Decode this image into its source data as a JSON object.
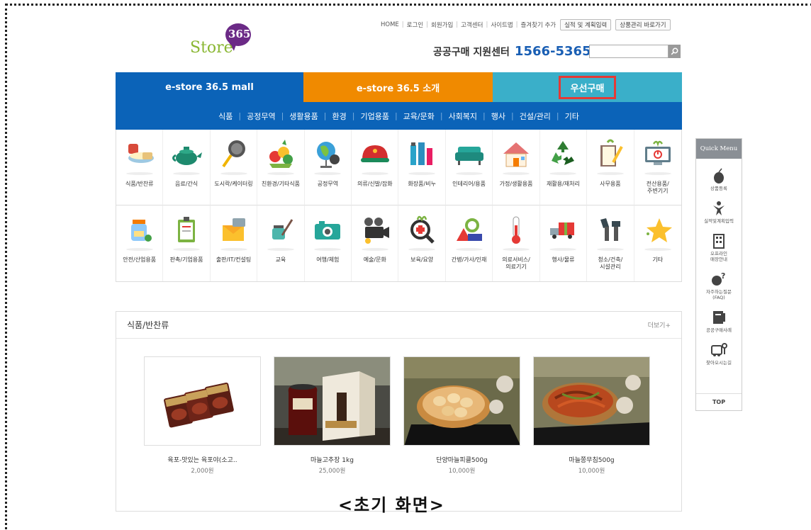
{
  "top_links": {
    "items": [
      "HOME",
      "로그인",
      "회원가입",
      "고객센터",
      "사이트맵",
      "즐겨찾기 추가"
    ],
    "buttons": [
      "실적 및 계획입력",
      "상품관리 바로가기"
    ]
  },
  "logo": {
    "number": "365",
    "word": "Store"
  },
  "support": {
    "label": "공공구매 지원센터",
    "phone": "1566-5365"
  },
  "tabs": [
    "e-store 36.5 mall",
    "e-store 36.5 소개",
    "우선구매"
  ],
  "subnav": [
    "식품",
    "공정무역",
    "생활용품",
    "환경",
    "기업용품",
    "교육/문화",
    "사회복지",
    "행사",
    "건설/관리",
    "기타"
  ],
  "categories": [
    {
      "label": "식품/반찬류",
      "icon": "food-bowl-icon"
    },
    {
      "label": "음료/간식",
      "icon": "teapot-icon"
    },
    {
      "label": "도시락/케이터링",
      "icon": "frying-pan-icon"
    },
    {
      "label": "친환경/기타식품",
      "icon": "vegetables-icon"
    },
    {
      "label": "공정무역",
      "icon": "globe-icon"
    },
    {
      "label": "의류/신발/잡화",
      "icon": "cap-icon"
    },
    {
      "label": "화장품/비누",
      "icon": "cosmetics-icon"
    },
    {
      "label": "인테리어/용품",
      "icon": "sofa-icon"
    },
    {
      "label": "가정/생활용품",
      "icon": "house-icon"
    },
    {
      "label": "재활용/재처리",
      "icon": "recycle-icon"
    },
    {
      "label": "사무용품",
      "icon": "notebook-pencil-icon"
    },
    {
      "label": "전산용품/\n주변기기",
      "icon": "monitor-icon"
    },
    {
      "label": "안전/산업용품",
      "icon": "safety-jar-icon"
    },
    {
      "label": "판촉/기업용품",
      "icon": "clipboard-icon"
    },
    {
      "label": "출판/IT/컨설팅",
      "icon": "envelope-icon"
    },
    {
      "label": "교육",
      "icon": "ink-pen-icon"
    },
    {
      "label": "여행/체험",
      "icon": "camera-icon"
    },
    {
      "label": "예술/문화",
      "icon": "film-camera-icon"
    },
    {
      "label": "보육/요양",
      "icon": "magnifier-plus-icon"
    },
    {
      "label": "간병/가사/인재",
      "icon": "tools-icon"
    },
    {
      "label": "의료서비스/\n의료기기",
      "icon": "thermometer-icon"
    },
    {
      "label": "행사/물류",
      "icon": "delivery-truck-icon"
    },
    {
      "label": "청소/건축/\n시설관리",
      "icon": "wrench-icon"
    },
    {
      "label": "기타",
      "icon": "star-icon"
    }
  ],
  "quick_menu": {
    "title": "Quick Menu",
    "items": [
      {
        "label": "상품등록",
        "icon": "mouse-icon"
      },
      {
        "label": "실적및계획입력",
        "icon": "person-icon"
      },
      {
        "label": "오프라인\n매장안내",
        "icon": "building-icon"
      },
      {
        "label": "자주하는질문\n(FAQ)",
        "icon": "question-icon"
      },
      {
        "label": "공공구매사례",
        "icon": "book-icon"
      },
      {
        "label": "찾아오시는길",
        "icon": "bus-icon"
      }
    ],
    "top": "TOP"
  },
  "section": {
    "title": "식품/반찬류",
    "more": "더보기+",
    "products": [
      {
        "name": "육포-맛있는 육포야(소고..",
        "price": "2,000원"
      },
      {
        "name": "마늘고추장 1kg",
        "price": "25,000원"
      },
      {
        "name": "단양마늘피클500g",
        "price": "10,000원"
      },
      {
        "name": "마늘쫑무침500g",
        "price": "10,000원"
      }
    ]
  },
  "caption": "<초기 화면>"
}
